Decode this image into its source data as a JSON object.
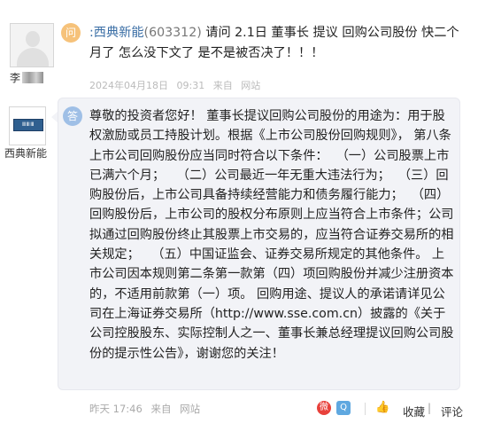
{
  "question": {
    "badge": "问",
    "asker_name": "李",
    "company_tag": ":西典新能",
    "stock_code": "(603312)",
    "text": " 请问 2.1日 董事长 提议 回购公司股份 快二个月了 怎么没下文了 是不是被否决了！！！",
    "date": "2024年04月18日",
    "time": "09:31",
    "source_prefix": "来自",
    "source": "网站"
  },
  "answer": {
    "badge": "答",
    "company_name": "西典新能",
    "text": "尊敬的投资者您好！ 董事长提议回购公司股份的用途为：用于股权激励或员工持股计划。根据《上市公司股份回购规则》， 第八条 上市公司回购股份应当同时符合以下条件：  （一）公司股票上市已满六个月；   （二）公司最近一年无重大违法行为；  （三）回购股份后，上市公司具备持续经营能力和债务履行能力；  （四）回购股份后，上市公司的股权分布原则上应当符合上市条件；公司拟通过回购股份终止其股票上市交易的，应当符合证券交易所的相关规定；   （五）中国证监会、证券交易所规定的其他条件。 上市公司因本规则第二条第一款第（四）项回购股份并减少注册资本的，不适用前款第（一）项。 回购用途、提议人的承诺请详见公司在上海证券交易所（http://www.sse.com.cn）披露的《关于公司控股股东、实际控制人之一、董事长兼总经理提议回购公司股份的提示性公告》，谢谢您的关注！",
    "time": "昨天 17:46",
    "source_prefix": "来自",
    "source": "网站"
  },
  "actions": {
    "favorite": "收藏",
    "comment": "评论"
  },
  "icons": {
    "weibo": "weibo-share-icon",
    "qzone": "qzone-share-icon",
    "thumb": "thumb-up-icon",
    "comment": "comment-icon"
  },
  "colors": {
    "bubble_bg": "#f2f3f7",
    "question_badge": "#f6c27a",
    "answer_badge": "#9fbfe6",
    "link_blue": "#3a6ea5"
  }
}
